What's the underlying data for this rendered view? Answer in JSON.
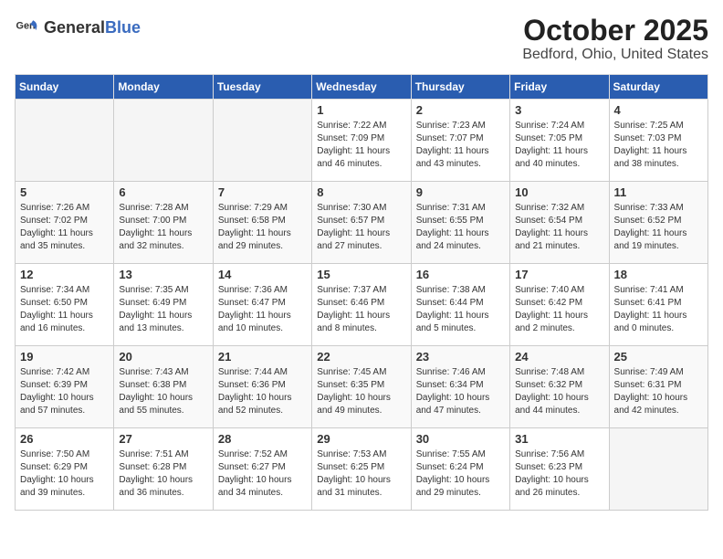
{
  "header": {
    "logo_general": "General",
    "logo_blue": "Blue",
    "month_title": "October 2025",
    "location": "Bedford, Ohio, United States"
  },
  "days_of_week": [
    "Sunday",
    "Monday",
    "Tuesday",
    "Wednesday",
    "Thursday",
    "Friday",
    "Saturday"
  ],
  "weeks": [
    [
      {
        "day": "",
        "empty": true
      },
      {
        "day": "",
        "empty": true
      },
      {
        "day": "",
        "empty": true
      },
      {
        "day": "1",
        "sunrise": "7:22 AM",
        "sunset": "7:09 PM",
        "daylight": "11 hours and 46 minutes."
      },
      {
        "day": "2",
        "sunrise": "7:23 AM",
        "sunset": "7:07 PM",
        "daylight": "11 hours and 43 minutes."
      },
      {
        "day": "3",
        "sunrise": "7:24 AM",
        "sunset": "7:05 PM",
        "daylight": "11 hours and 40 minutes."
      },
      {
        "day": "4",
        "sunrise": "7:25 AM",
        "sunset": "7:03 PM",
        "daylight": "11 hours and 38 minutes."
      }
    ],
    [
      {
        "day": "5",
        "sunrise": "7:26 AM",
        "sunset": "7:02 PM",
        "daylight": "11 hours and 35 minutes."
      },
      {
        "day": "6",
        "sunrise": "7:28 AM",
        "sunset": "7:00 PM",
        "daylight": "11 hours and 32 minutes."
      },
      {
        "day": "7",
        "sunrise": "7:29 AM",
        "sunset": "6:58 PM",
        "daylight": "11 hours and 29 minutes."
      },
      {
        "day": "8",
        "sunrise": "7:30 AM",
        "sunset": "6:57 PM",
        "daylight": "11 hours and 27 minutes."
      },
      {
        "day": "9",
        "sunrise": "7:31 AM",
        "sunset": "6:55 PM",
        "daylight": "11 hours and 24 minutes."
      },
      {
        "day": "10",
        "sunrise": "7:32 AM",
        "sunset": "6:54 PM",
        "daylight": "11 hours and 21 minutes."
      },
      {
        "day": "11",
        "sunrise": "7:33 AM",
        "sunset": "6:52 PM",
        "daylight": "11 hours and 19 minutes."
      }
    ],
    [
      {
        "day": "12",
        "sunrise": "7:34 AM",
        "sunset": "6:50 PM",
        "daylight": "11 hours and 16 minutes."
      },
      {
        "day": "13",
        "sunrise": "7:35 AM",
        "sunset": "6:49 PM",
        "daylight": "11 hours and 13 minutes."
      },
      {
        "day": "14",
        "sunrise": "7:36 AM",
        "sunset": "6:47 PM",
        "daylight": "11 hours and 10 minutes."
      },
      {
        "day": "15",
        "sunrise": "7:37 AM",
        "sunset": "6:46 PM",
        "daylight": "11 hours and 8 minutes."
      },
      {
        "day": "16",
        "sunrise": "7:38 AM",
        "sunset": "6:44 PM",
        "daylight": "11 hours and 5 minutes."
      },
      {
        "day": "17",
        "sunrise": "7:40 AM",
        "sunset": "6:42 PM",
        "daylight": "11 hours and 2 minutes."
      },
      {
        "day": "18",
        "sunrise": "7:41 AM",
        "sunset": "6:41 PM",
        "daylight": "11 hours and 0 minutes."
      }
    ],
    [
      {
        "day": "19",
        "sunrise": "7:42 AM",
        "sunset": "6:39 PM",
        "daylight": "10 hours and 57 minutes."
      },
      {
        "day": "20",
        "sunrise": "7:43 AM",
        "sunset": "6:38 PM",
        "daylight": "10 hours and 55 minutes."
      },
      {
        "day": "21",
        "sunrise": "7:44 AM",
        "sunset": "6:36 PM",
        "daylight": "10 hours and 52 minutes."
      },
      {
        "day": "22",
        "sunrise": "7:45 AM",
        "sunset": "6:35 PM",
        "daylight": "10 hours and 49 minutes."
      },
      {
        "day": "23",
        "sunrise": "7:46 AM",
        "sunset": "6:34 PM",
        "daylight": "10 hours and 47 minutes."
      },
      {
        "day": "24",
        "sunrise": "7:48 AM",
        "sunset": "6:32 PM",
        "daylight": "10 hours and 44 minutes."
      },
      {
        "day": "25",
        "sunrise": "7:49 AM",
        "sunset": "6:31 PM",
        "daylight": "10 hours and 42 minutes."
      }
    ],
    [
      {
        "day": "26",
        "sunrise": "7:50 AM",
        "sunset": "6:29 PM",
        "daylight": "10 hours and 39 minutes."
      },
      {
        "day": "27",
        "sunrise": "7:51 AM",
        "sunset": "6:28 PM",
        "daylight": "10 hours and 36 minutes."
      },
      {
        "day": "28",
        "sunrise": "7:52 AM",
        "sunset": "6:27 PM",
        "daylight": "10 hours and 34 minutes."
      },
      {
        "day": "29",
        "sunrise": "7:53 AM",
        "sunset": "6:25 PM",
        "daylight": "10 hours and 31 minutes."
      },
      {
        "day": "30",
        "sunrise": "7:55 AM",
        "sunset": "6:24 PM",
        "daylight": "10 hours and 29 minutes."
      },
      {
        "day": "31",
        "sunrise": "7:56 AM",
        "sunset": "6:23 PM",
        "daylight": "10 hours and 26 minutes."
      },
      {
        "day": "",
        "empty": true
      }
    ]
  ]
}
